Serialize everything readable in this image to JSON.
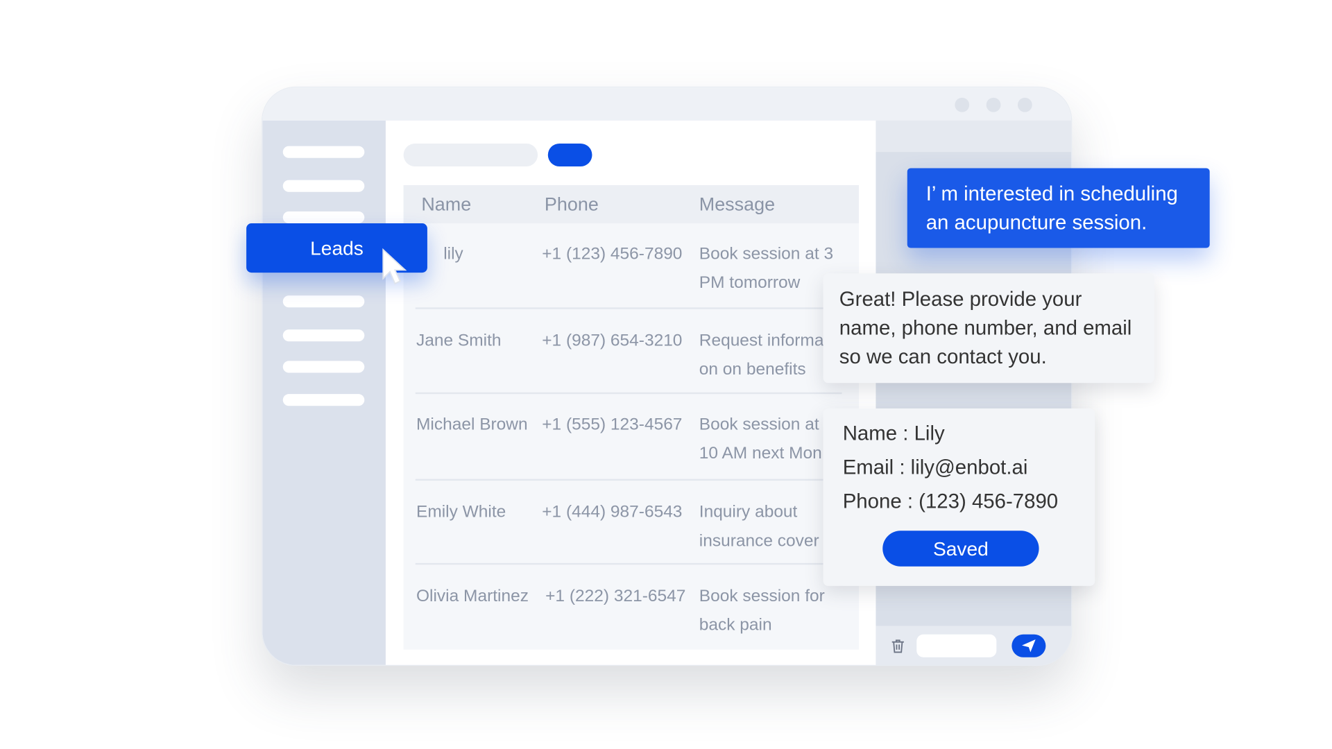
{
  "colors": {
    "accent": "#0a4fe6",
    "sidebar": "#dbe1ec",
    "panel": "#d9dfe9"
  },
  "nav": {
    "active_label": "Leads"
  },
  "table": {
    "headers": [
      "Name",
      "Phone",
      "Message"
    ],
    "rows": [
      {
        "name": "lily",
        "phone": "+1 (123) 456-7890",
        "message": [
          "Book session at 3",
          "PM tomorrow"
        ]
      },
      {
        "name": "Jane Smith",
        "phone": "+1 (987) 654-3210",
        "message": [
          "Request informati",
          "on on benefits"
        ]
      },
      {
        "name": "Michael Brown",
        "phone": "+1 (555) 123-4567",
        "message": [
          "Book session at",
          "10 AM next Mon"
        ]
      },
      {
        "name": "Emily White",
        "phone": "+1 (444) 987-6543",
        "message": [
          "Inquiry about",
          "insurance cover"
        ]
      },
      {
        "name": "Olivia Martinez",
        "phone": "+1 (222) 321-6547",
        "message": [
          "Book session for",
          "back pain"
        ]
      }
    ]
  },
  "chat": {
    "user_message": "I’  m interested in scheduling an acupuncture session.",
    "bot_message": "Great! Please provide your name, phone number, and email so we can contact you.",
    "card": {
      "name": "Name : Lily",
      "email": "Email : lily@enbot.ai",
      "phone": "Phone : (123) 456-7890",
      "button": "Saved"
    }
  },
  "icons": {
    "delete": "trash-icon",
    "send": "send-icon",
    "cursor": "cursor-arrow-icon"
  }
}
